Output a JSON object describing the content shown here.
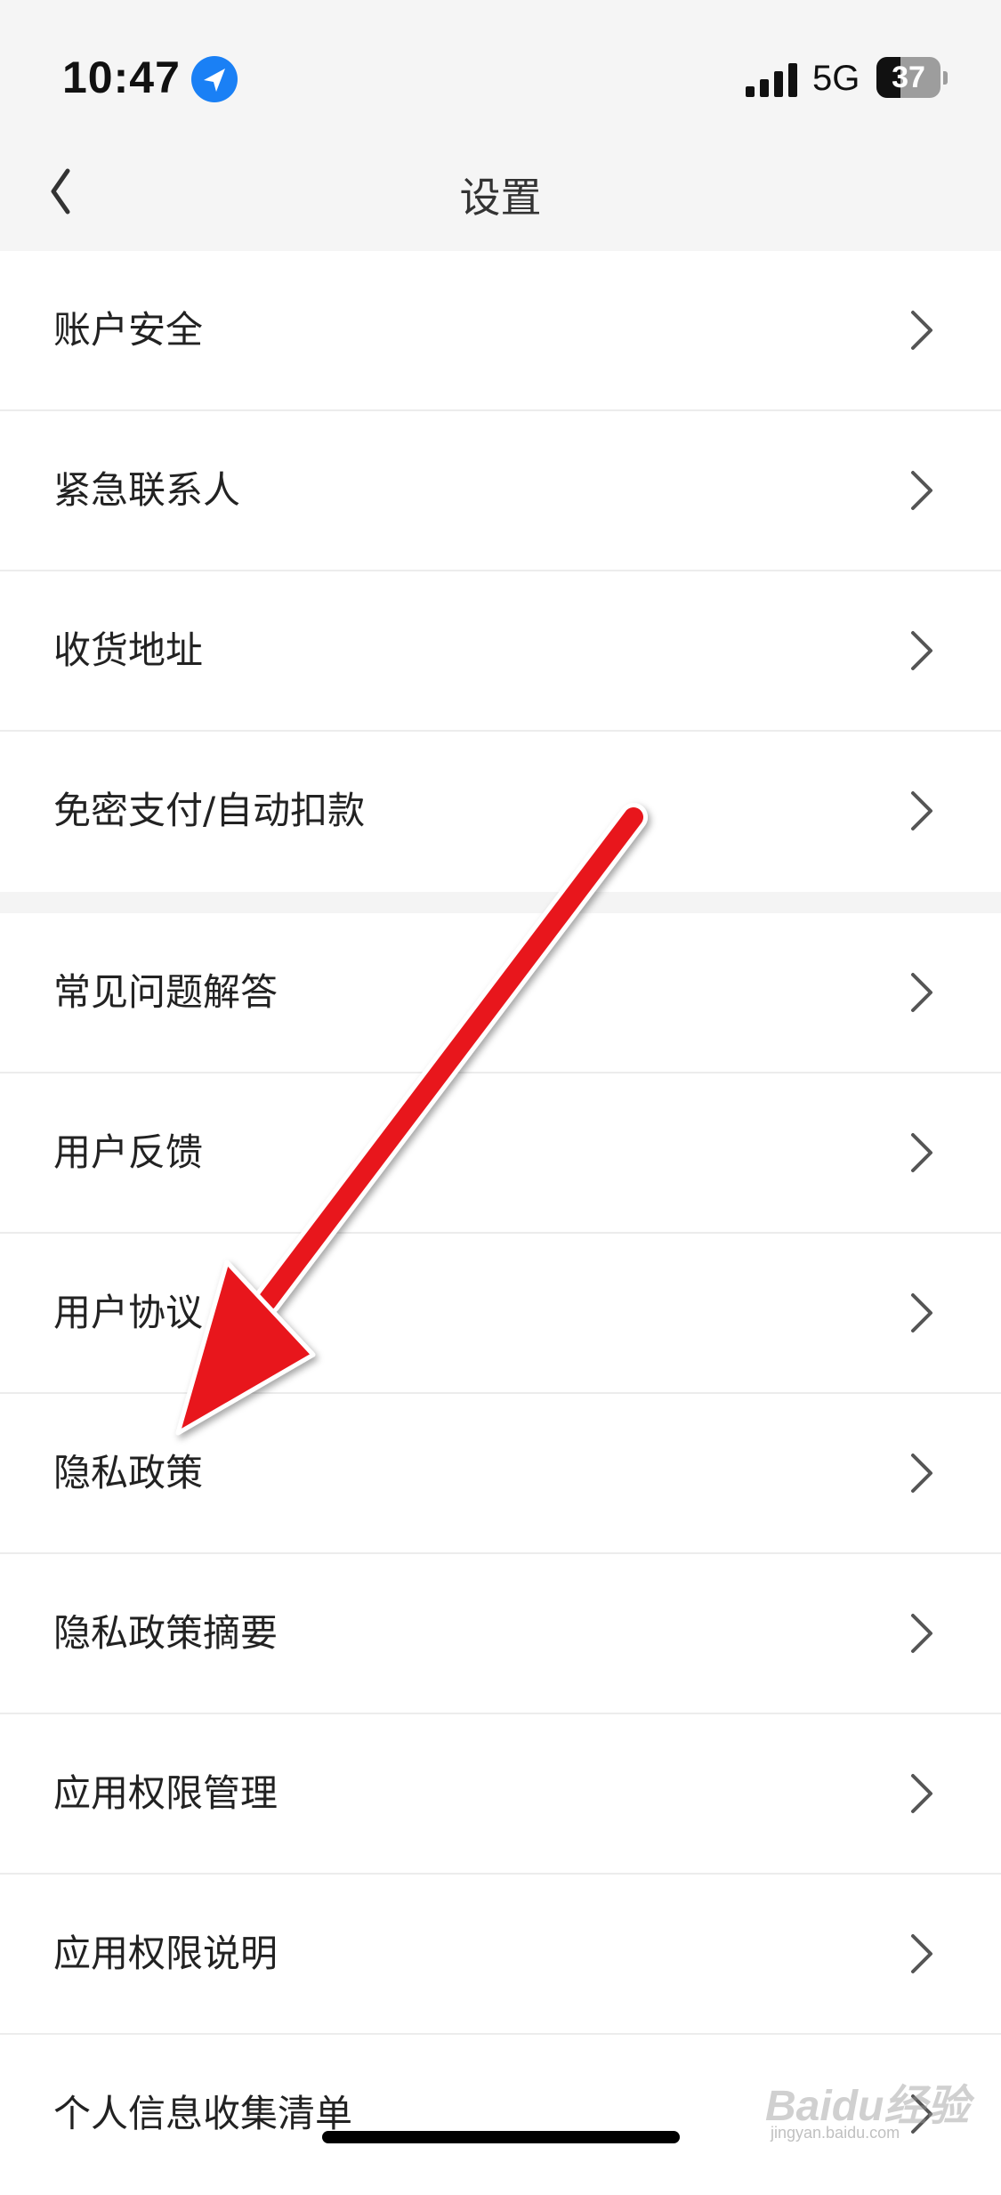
{
  "status_bar": {
    "time": "10:47",
    "network": "5G",
    "battery_level": "37",
    "battery_fraction": 0.37
  },
  "header": {
    "title": "设置",
    "back_icon": "chevron-left-icon"
  },
  "groups": [
    {
      "items": [
        {
          "label": "账户安全"
        },
        {
          "label": "紧急联系人"
        },
        {
          "label": "收货地址"
        },
        {
          "label": "免密支付/自动扣款"
        }
      ]
    },
    {
      "items": [
        {
          "label": "常见问题解答"
        },
        {
          "label": "用户反馈"
        },
        {
          "label": "用户协议"
        },
        {
          "label": "隐私政策"
        },
        {
          "label": "隐私政策摘要"
        },
        {
          "label": "应用权限管理"
        },
        {
          "label": "应用权限说明"
        },
        {
          "label": "个人信息收集清单"
        }
      ]
    }
  ],
  "row_icon": "chevron-right-icon",
  "annotation": {
    "type": "arrow",
    "color": "#e8121b",
    "points_to": "隐私政策"
  },
  "watermark": {
    "main": "Baidu经验",
    "url": "jingyan.baidu.com"
  }
}
